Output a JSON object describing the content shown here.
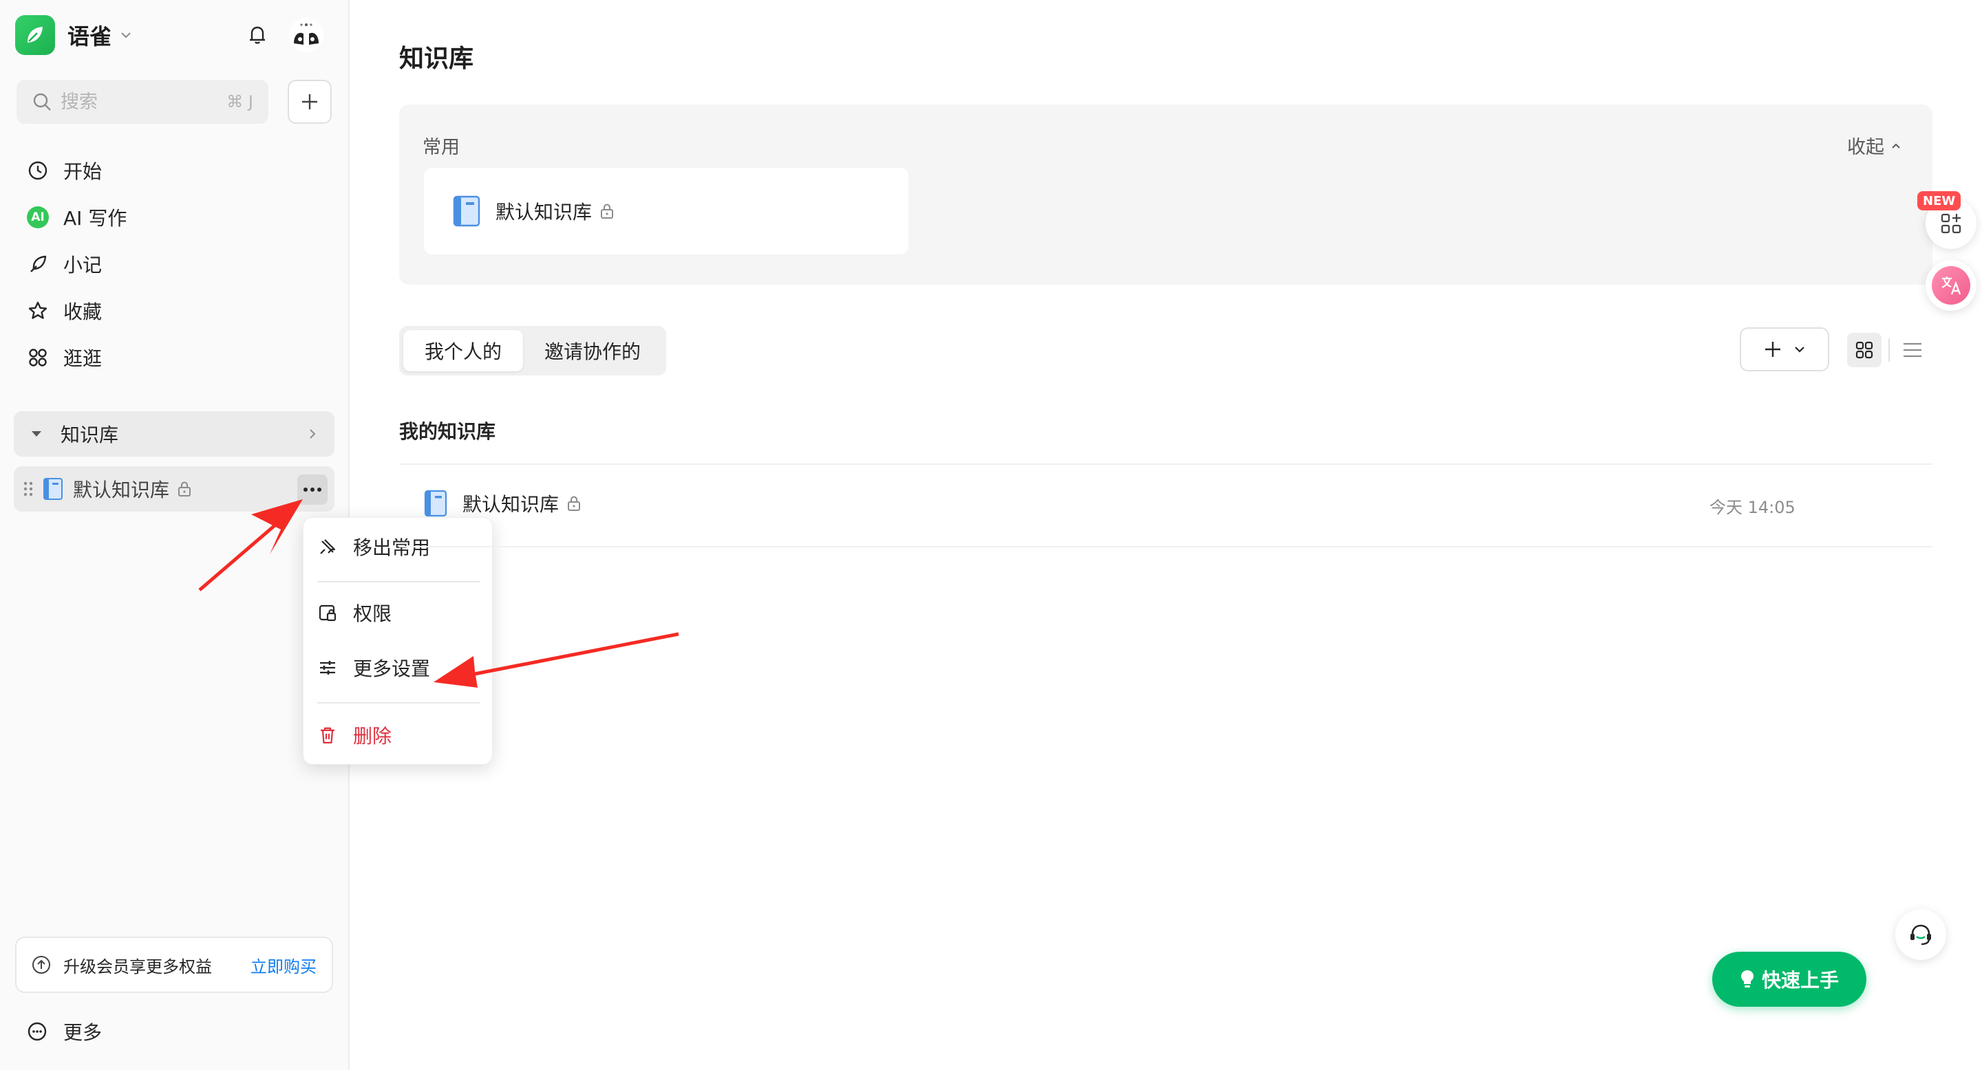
{
  "app": {
    "name": "语雀"
  },
  "search": {
    "placeholder": "搜索",
    "shortcut": "⌘ J"
  },
  "nav": {
    "start": "开始",
    "ai_write": "AI 写作",
    "ai_badge": "AI",
    "notes": "小记",
    "favorites": "收藏",
    "explore": "逛逛"
  },
  "sidebar_kb": {
    "header": "知识库",
    "item": "默认知识库"
  },
  "context_menu": {
    "remove_common": "移出常用",
    "permissions": "权限",
    "more_settings": "更多设置",
    "delete": "删除"
  },
  "upgrade": {
    "text": "升级会员享更多权益",
    "link": "立即购买"
  },
  "more": "更多",
  "main": {
    "title": "知识库",
    "common": {
      "label": "常用",
      "collapse": "收起",
      "card": "默认知识库"
    },
    "tabs": {
      "personal": "我个人的",
      "invited": "邀请协作的"
    },
    "section_title": "我的知识库",
    "row": {
      "name": "默认知识库",
      "time": "今天 14:05"
    }
  },
  "float": {
    "new_badge": "NEW",
    "quick_start": "快速上手"
  },
  "colors": {
    "brand_green": "#1bb14f",
    "danger": "#e0303f",
    "link": "#117cee",
    "annotation": "#f52a24"
  }
}
